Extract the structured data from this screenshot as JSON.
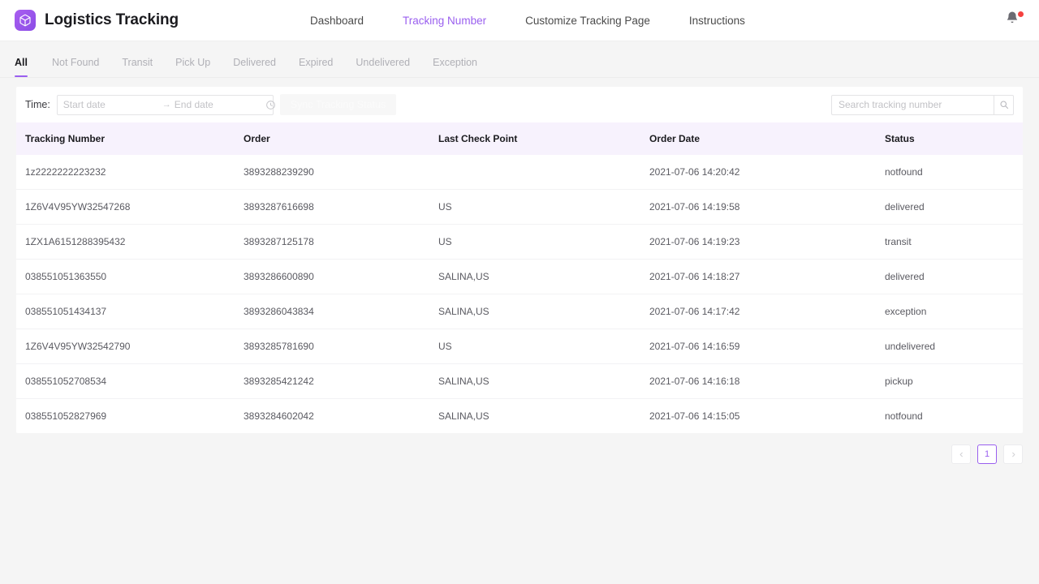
{
  "header": {
    "logo_icon": "package-cube-icon",
    "title": "Logistics Tracking",
    "nav": [
      {
        "label": "Dashboard",
        "active": false
      },
      {
        "label": "Tracking Number",
        "active": true
      },
      {
        "label": "Customize Tracking Page",
        "active": false
      },
      {
        "label": "Instructions",
        "active": false
      }
    ],
    "notification_icon": "bell-icon",
    "has_notification": true,
    "accent_color": "#9a5fef"
  },
  "tabs": [
    {
      "label": "All",
      "active": true
    },
    {
      "label": "Not Found",
      "active": false
    },
    {
      "label": "Transit",
      "active": false
    },
    {
      "label": "Pick Up",
      "active": false
    },
    {
      "label": "Delivered",
      "active": false
    },
    {
      "label": "Expired",
      "active": false
    },
    {
      "label": "Undelivered",
      "active": false
    },
    {
      "label": "Exception",
      "active": false
    }
  ],
  "filters": {
    "time_label": "Time:",
    "start_date_placeholder": "Start date",
    "start_date_value": "",
    "end_date_placeholder": "End date",
    "end_date_value": "",
    "range_separator": "→",
    "clock_icon": "clock-icon",
    "sync_button_label": "Sync Tracking Status",
    "sync_button_disabled": true,
    "search_placeholder": "Search tracking number",
    "search_value": "",
    "search_icon": "search-icon"
  },
  "table": {
    "columns": [
      "Tracking Number",
      "Order",
      "Last Check Point",
      "Order Date",
      "Status"
    ],
    "rows": [
      {
        "tracking_number": "1z2222222223232",
        "order": "3893288239290",
        "last_check_point": "",
        "order_date": "2021-07-06 14:20:42",
        "status": "notfound"
      },
      {
        "tracking_number": "1Z6V4V95YW32547268",
        "order": "3893287616698",
        "last_check_point": "US",
        "order_date": "2021-07-06 14:19:58",
        "status": "delivered"
      },
      {
        "tracking_number": "1ZX1A6151288395432",
        "order": "3893287125178",
        "last_check_point": "US",
        "order_date": "2021-07-06 14:19:23",
        "status": "transit"
      },
      {
        "tracking_number": "038551051363550",
        "order": "3893286600890",
        "last_check_point": "SALINA,US",
        "order_date": "2021-07-06 14:18:27",
        "status": "delivered"
      },
      {
        "tracking_number": "038551051434137",
        "order": "3893286043834",
        "last_check_point": "SALINA,US",
        "order_date": "2021-07-06 14:17:42",
        "status": "exception"
      },
      {
        "tracking_number": "1Z6V4V95YW32542790",
        "order": "3893285781690",
        "last_check_point": "US",
        "order_date": "2021-07-06 14:16:59",
        "status": "undelivered"
      },
      {
        "tracking_number": "038551052708534",
        "order": "3893285421242",
        "last_check_point": "SALINA,US",
        "order_date": "2021-07-06 14:16:18",
        "status": "pickup"
      },
      {
        "tracking_number": "038551052827969",
        "order": "3893284602042",
        "last_check_point": "SALINA,US",
        "order_date": "2021-07-06 14:15:05",
        "status": "notfound"
      }
    ]
  },
  "pagination": {
    "prev_icon": "chevron-left-icon",
    "next_icon": "chevron-right-icon",
    "current_page": "1"
  }
}
